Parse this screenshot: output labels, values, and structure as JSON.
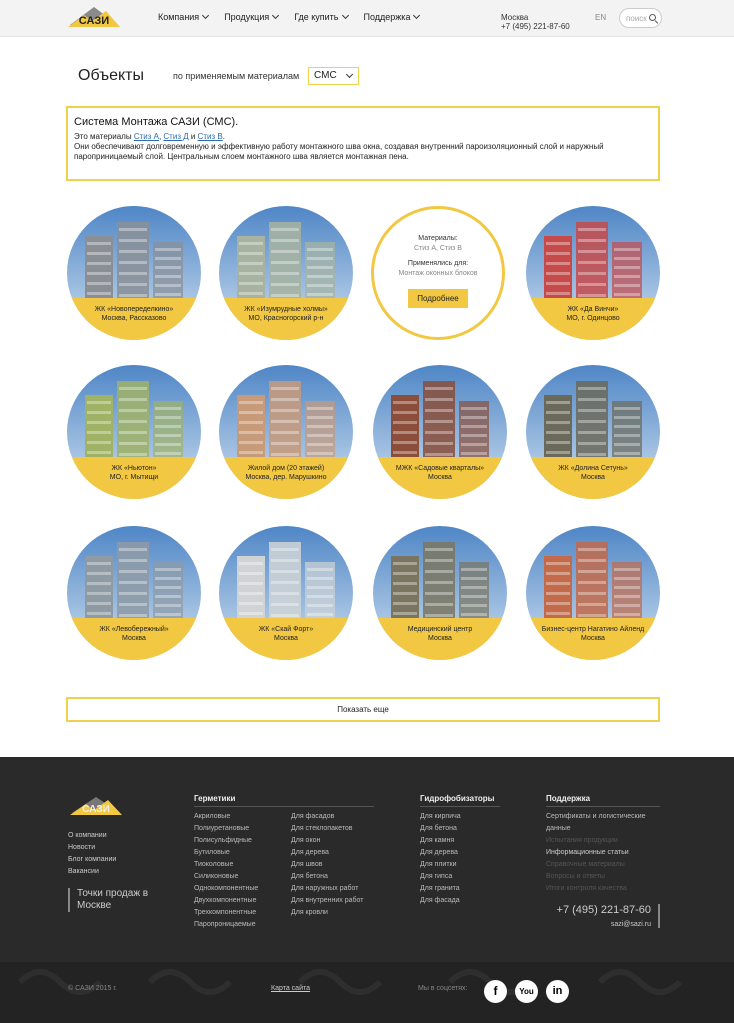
{
  "header": {
    "logo_text": "САЗИ",
    "nav": [
      {
        "label": "Компания"
      },
      {
        "label": "Продукция"
      },
      {
        "label": "Где купить"
      },
      {
        "label": "Поддержка"
      }
    ],
    "city": "Москва",
    "phone": "+7 (495) 221-87-60",
    "lang": "EN",
    "search_placeholder": "поиск"
  },
  "page": {
    "title": "Объекты",
    "filter_label": "по применяемым материалам",
    "filter_value": "СМС"
  },
  "info": {
    "heading": "Система Монтажа САЗИ (СМС).",
    "line1_prefix": "Это материалы ",
    "link1": "Стиз А",
    "sep1": ", ",
    "link2": "Стиз Д",
    "sep2": " и ",
    "link3": "Стиз В",
    "line1_suffix": ".",
    "text": "Они обеспечивают долговременную и эффективную работу монтажного шва окна, создавая внутренний пароизоляционный слой и наружный пароприницаемый слой. Центральным слоем монтажного шва является монтажная пена."
  },
  "objects": [
    {
      "name": "ЖК «Новопеределкино»",
      "place": "Москва, Рассказово",
      "color": "#8a8f96"
    },
    {
      "name": "ЖК «Изумрудные холмы»",
      "place": "МО, Красногорский р-н",
      "color": "#a7b3a0"
    },
    {
      "name": "ЖК «Да Винчи»",
      "place": "МО, г. Одинцово",
      "color": "#c64a4a"
    },
    {
      "name": "ЖК «Ньютон»",
      "place": "МО, г. Мытищи",
      "color": "#9fb266"
    },
    {
      "name": "Жилой дом (20 этажей)",
      "place": "Москва, дер. Марушкино",
      "color": "#c79a7a"
    },
    {
      "name": "МЖК «Садовые кварталы»",
      "place": "Москва",
      "color": "#8a4e3a"
    },
    {
      "name": "ЖК «Долина Сетунь»",
      "place": "Москва",
      "color": "#6b6a5a"
    },
    {
      "name": "ЖК «Левобережный»",
      "place": "Москва",
      "color": "#8e9aa4"
    },
    {
      "name": "ЖК «Скай Форт»",
      "place": "Москва",
      "color": "#cfd3d6"
    },
    {
      "name": "Медицинский центр",
      "place": "Москва",
      "color": "#7a7560"
    },
    {
      "name": "Бизнес-центр Нагатино Айленд",
      "place": "Москва",
      "color": "#c26a4a"
    }
  ],
  "info_card": {
    "materials_label": "Материалы:",
    "materials_value": "Стиз А, Стиз В",
    "applied_label": "Применялись для:",
    "applied_value": "Монтаж оконных блоков",
    "button": "Подробнее"
  },
  "show_more": "Показать еще",
  "footer": {
    "links": [
      "О компании",
      "Новости",
      "Блог компании",
      "Вакансии"
    ],
    "points": "Точки продаж в Москве",
    "germetiki_title": "Герметики",
    "germetiki_col1": [
      "Акриловые",
      "Полиуретановые",
      "Полисульфидные",
      "Бутиловые",
      "Тиоколовые",
      "Силиконовые",
      "Однокомпонентные",
      "Двухкомпонентные",
      "Трехкомпонентные",
      "Паропроницаемые"
    ],
    "germetiki_col2": [
      "Для фасадов",
      "Для стеклопакетов",
      "Для окон",
      "Для дерева",
      "Для швов",
      "Для бетона",
      "Для наружных работ",
      "Для внутренних работ",
      "Для кровли"
    ],
    "hydro_title": "Гидрофобизаторы",
    "hydro": [
      "Для кирпича",
      "Для бетона",
      "Для камня",
      "Для дерева",
      "Для плитки",
      "Для гипса",
      "Для гранита",
      "Для фасада"
    ],
    "support_title": "Поддержка",
    "support": [
      "Сертификаты и логистические данные",
      "Испытания продукции",
      "Информационные статьи",
      "Справочные материалы",
      "Вопросы и ответы",
      "Итоги контроля качества"
    ],
    "phone": "+7 (495) 221-87-60",
    "email": "sazi@sazi.ru",
    "copyright": "© САЗИ 2015 г.",
    "sitemap": "Карта сайта",
    "social_label": "Мы в соцсетях:",
    "social": [
      "facebook-icon",
      "youtube-icon",
      "linkedin-icon"
    ]
  }
}
